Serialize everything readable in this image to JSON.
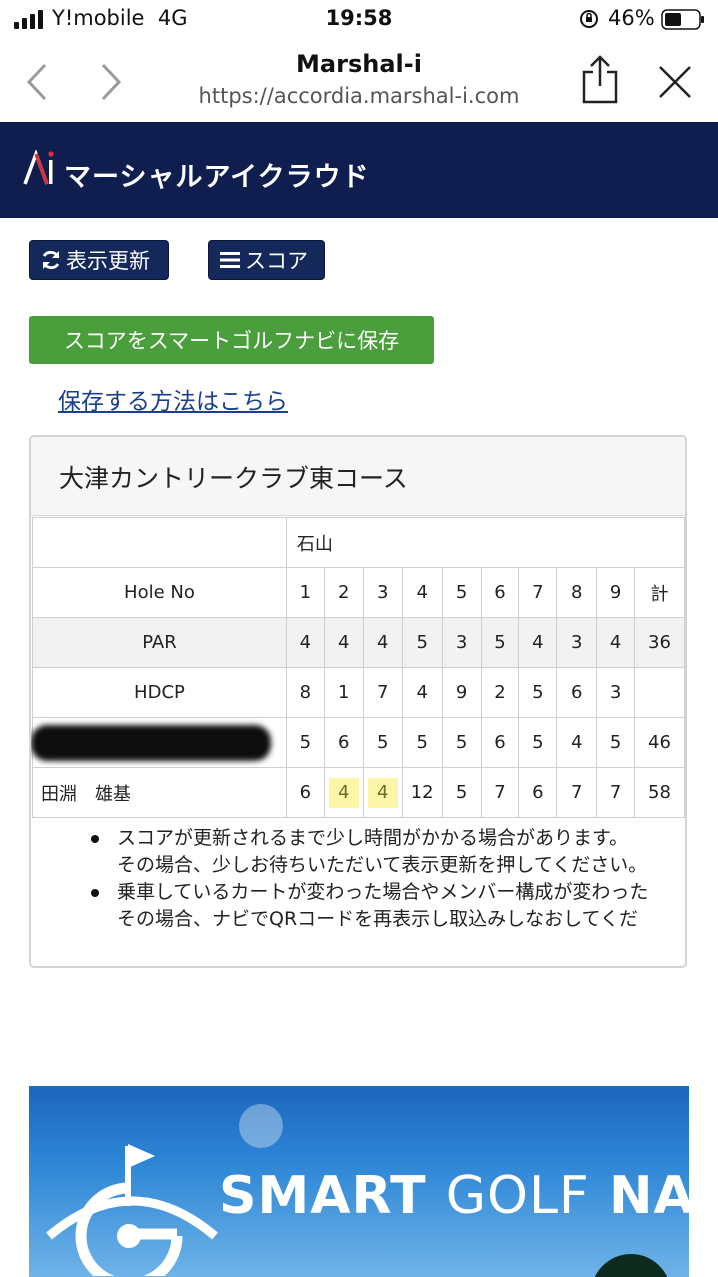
{
  "status_bar": {
    "carrier": "Y!mobile",
    "network": "4G",
    "time": "19:58",
    "battery": "46%"
  },
  "browser": {
    "title": "Marshal-i",
    "url": "https://accordia.marshal-i.com"
  },
  "header": {
    "logo_mark": "Ai",
    "app_name": "マーシャルアイクラウド"
  },
  "actions": {
    "refresh_label": "表示更新",
    "score_label": "スコア",
    "save_label": "スコアをスマートゴルフナビに保存",
    "howto_link": "保存する方法はこちら"
  },
  "scorecard": {
    "course_name": "大津カントリークラブ東コース",
    "section_name": "石山",
    "header_label": "Hole No",
    "holes": [
      "1",
      "2",
      "3",
      "4",
      "5",
      "6",
      "7",
      "8",
      "9",
      "計"
    ],
    "rows": [
      {
        "label": "PAR",
        "values": [
          "4",
          "4",
          "4",
          "5",
          "3",
          "5",
          "4",
          "3",
          "4",
          "36"
        ]
      },
      {
        "label": "HDCP",
        "values": [
          "8",
          "1",
          "7",
          "4",
          "9",
          "2",
          "5",
          "6",
          "3",
          ""
        ]
      },
      {
        "label": "",
        "redacted": true,
        "values": [
          "5",
          "6",
          "5",
          "5",
          "5",
          "6",
          "5",
          "4",
          "5",
          "46"
        ]
      },
      {
        "label": "田淵　雄基",
        "values": [
          "6",
          "4",
          "4",
          "12",
          "5",
          "7",
          "6",
          "7",
          "7",
          "58"
        ]
      }
    ],
    "notes": [
      [
        "スコアが更新されるまで少し時間がかかる場合があります。",
        "その場合、少しお待ちいただいて表示更新を押してください。"
      ],
      [
        "乗車しているカートが変わった場合やメンバー構成が変わった",
        "その場合、ナビでQRコードを再表示し取込みしなおしてくだ"
      ]
    ]
  },
  "banner": {
    "word1": "SMART",
    "word2": "GOLF",
    "word3": "NAVi"
  },
  "colors": {
    "header_bg": "#0f1e4e",
    "button_dark": "#14285a",
    "button_green": "#4a9e3c",
    "link": "#1a3f8f",
    "highlight": "#fbf5a8"
  },
  "icons": [
    "signal-icon",
    "orientation-lock-icon",
    "battery-icon",
    "back-arrow-icon",
    "forward-arrow-icon",
    "share-icon",
    "close-icon",
    "refresh-icon",
    "menu-icon",
    "golf-flag-logo-icon"
  ]
}
